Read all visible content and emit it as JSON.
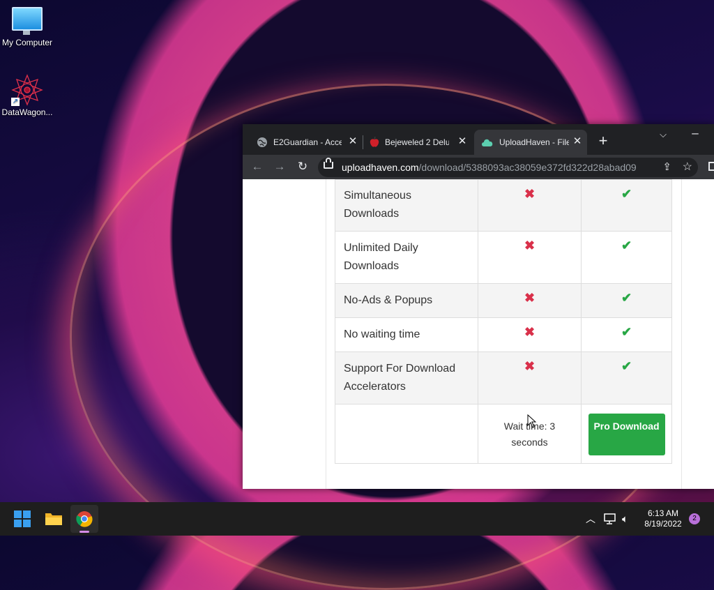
{
  "desktop": {
    "icons": [
      {
        "label": "My Computer"
      },
      {
        "label": "DataWagon..."
      }
    ]
  },
  "browser": {
    "tabs": [
      {
        "title": "E2Guardian - Acce",
        "icon": "globe-icon"
      },
      {
        "title": "Bejeweled 2 Delux",
        "icon": "apple-icon"
      },
      {
        "title": "UploadHaven - File",
        "icon": "cloud-icon",
        "active": true
      }
    ],
    "new_tab_label": "+",
    "url": {
      "domain": "uploadhaven.com",
      "path": "/download/5388093ac38059e372fd322d28abad09"
    }
  },
  "comparison": {
    "rows": [
      {
        "feature": "Simultaneous Downloads",
        "free": "✖",
        "pro": "✔"
      },
      {
        "feature": "Unlimited Daily Downloads",
        "free": "✖",
        "pro": "✔"
      },
      {
        "feature": "No-Ads & Popups",
        "free": "✖",
        "pro": "✔"
      },
      {
        "feature": "No waiting time",
        "free": "✖",
        "pro": "✔"
      },
      {
        "feature": "Support For Download Accelerators",
        "free": "✖",
        "pro": "✔"
      }
    ],
    "wait_text": "Wait time: 3 seconds",
    "pro_button": "Pro Download"
  },
  "colors": {
    "check": "#28a745",
    "cross": "#d9304a",
    "pro_button": "#28a745"
  },
  "taskbar": {
    "time": "6:13 AM",
    "date": "8/19/2022",
    "notification_count": "2"
  }
}
